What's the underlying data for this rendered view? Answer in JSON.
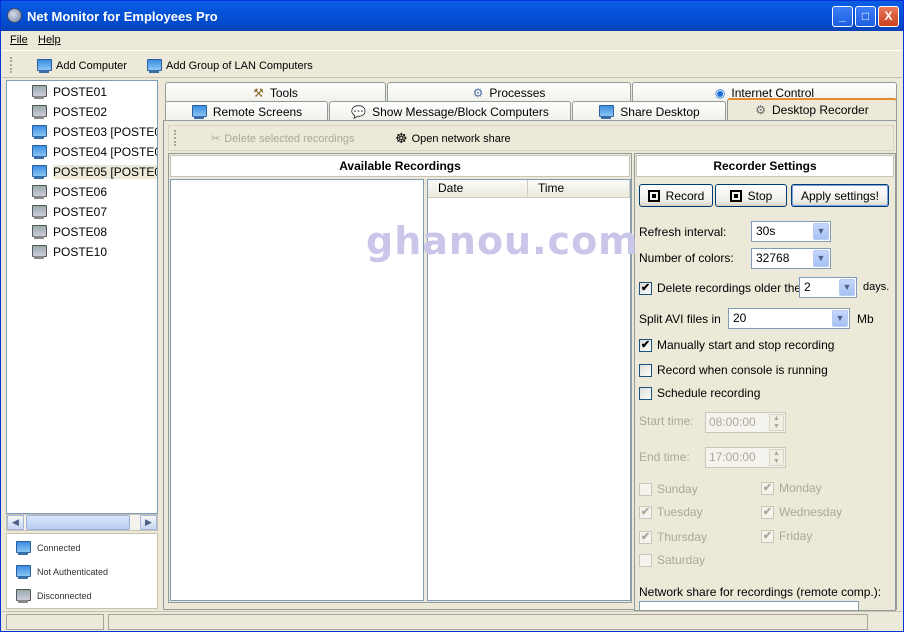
{
  "window": {
    "title": "Net Monitor for Employees Pro",
    "min": "_",
    "max": "□",
    "close": "X"
  },
  "menu": {
    "items": [
      "File",
      "Help"
    ]
  },
  "toolbar": {
    "add_computer": "Add Computer",
    "add_group": "Add Group of LAN Computers"
  },
  "tree": {
    "items": [
      {
        "label": "POSTE01",
        "status": "disconnected",
        "selected": false
      },
      {
        "label": "POSTE02",
        "status": "disconnected",
        "selected": false
      },
      {
        "label": "POSTE03 [POSTE03]",
        "status": "connected",
        "selected": false
      },
      {
        "label": "POSTE04 [POSTE04]",
        "status": "connected",
        "selected": false
      },
      {
        "label": "POSTE05 [POSTE05]",
        "status": "connected",
        "selected": true
      },
      {
        "label": "POSTE06",
        "status": "disconnected",
        "selected": false
      },
      {
        "label": "POSTE07",
        "status": "disconnected",
        "selected": false
      },
      {
        "label": "POSTE08",
        "status": "disconnected",
        "selected": false
      },
      {
        "label": "POSTE10",
        "status": "disconnected",
        "selected": false
      }
    ]
  },
  "legend": {
    "connected": "Connected",
    "not_authenticated": "Not Authenticated",
    "disconnected": "Disconnected"
  },
  "tabs": {
    "row1": [
      "Tools",
      "Processes",
      "Internet Control"
    ],
    "row2": [
      "Remote Screens",
      "Show Message/Block Computers",
      "Share Desktop",
      "Desktop Recorder"
    ],
    "active": "Desktop Recorder"
  },
  "recorder_toolbar": {
    "delete": "Delete selected recordings",
    "open_share": "Open network share"
  },
  "recordings": {
    "title": "Available Recordings",
    "columns": [
      "Date",
      "Time"
    ]
  },
  "settings": {
    "title": "Recorder Settings",
    "record_btn": "Record",
    "stop_btn": "Stop",
    "apply_btn": "Apply settings!",
    "refresh_label": "Refresh interval:",
    "refresh_value": "30s",
    "colors_label": "Number of colors:",
    "colors_value": "32768",
    "delete_older_label": "Delete recordings older then",
    "delete_older_value": "2",
    "days_label": "days.",
    "split_label": "Split AVI files in",
    "split_value": "20",
    "mb_label": "Mb",
    "manual_label": "Manually start and stop recording",
    "manual_checked": true,
    "console_label": "Record when console is running",
    "console_checked": false,
    "schedule_label": "Schedule recording",
    "schedule_checked": false,
    "start_label": "Start time:",
    "start_value": "08:00:00",
    "end_label": "End time:",
    "end_value": "17:00:00",
    "days": [
      {
        "label": "Sunday",
        "checked": false
      },
      {
        "label": "Monday",
        "checked": true
      },
      {
        "label": "Tuesday",
        "checked": true
      },
      {
        "label": "Wednesday",
        "checked": true
      },
      {
        "label": "Thursday",
        "checked": true
      },
      {
        "label": "Friday",
        "checked": true
      },
      {
        "label": "Saturday",
        "checked": false
      }
    ],
    "network_share_label": "Network share for recordings (remote comp.):"
  },
  "watermark": "ghanou.com"
}
